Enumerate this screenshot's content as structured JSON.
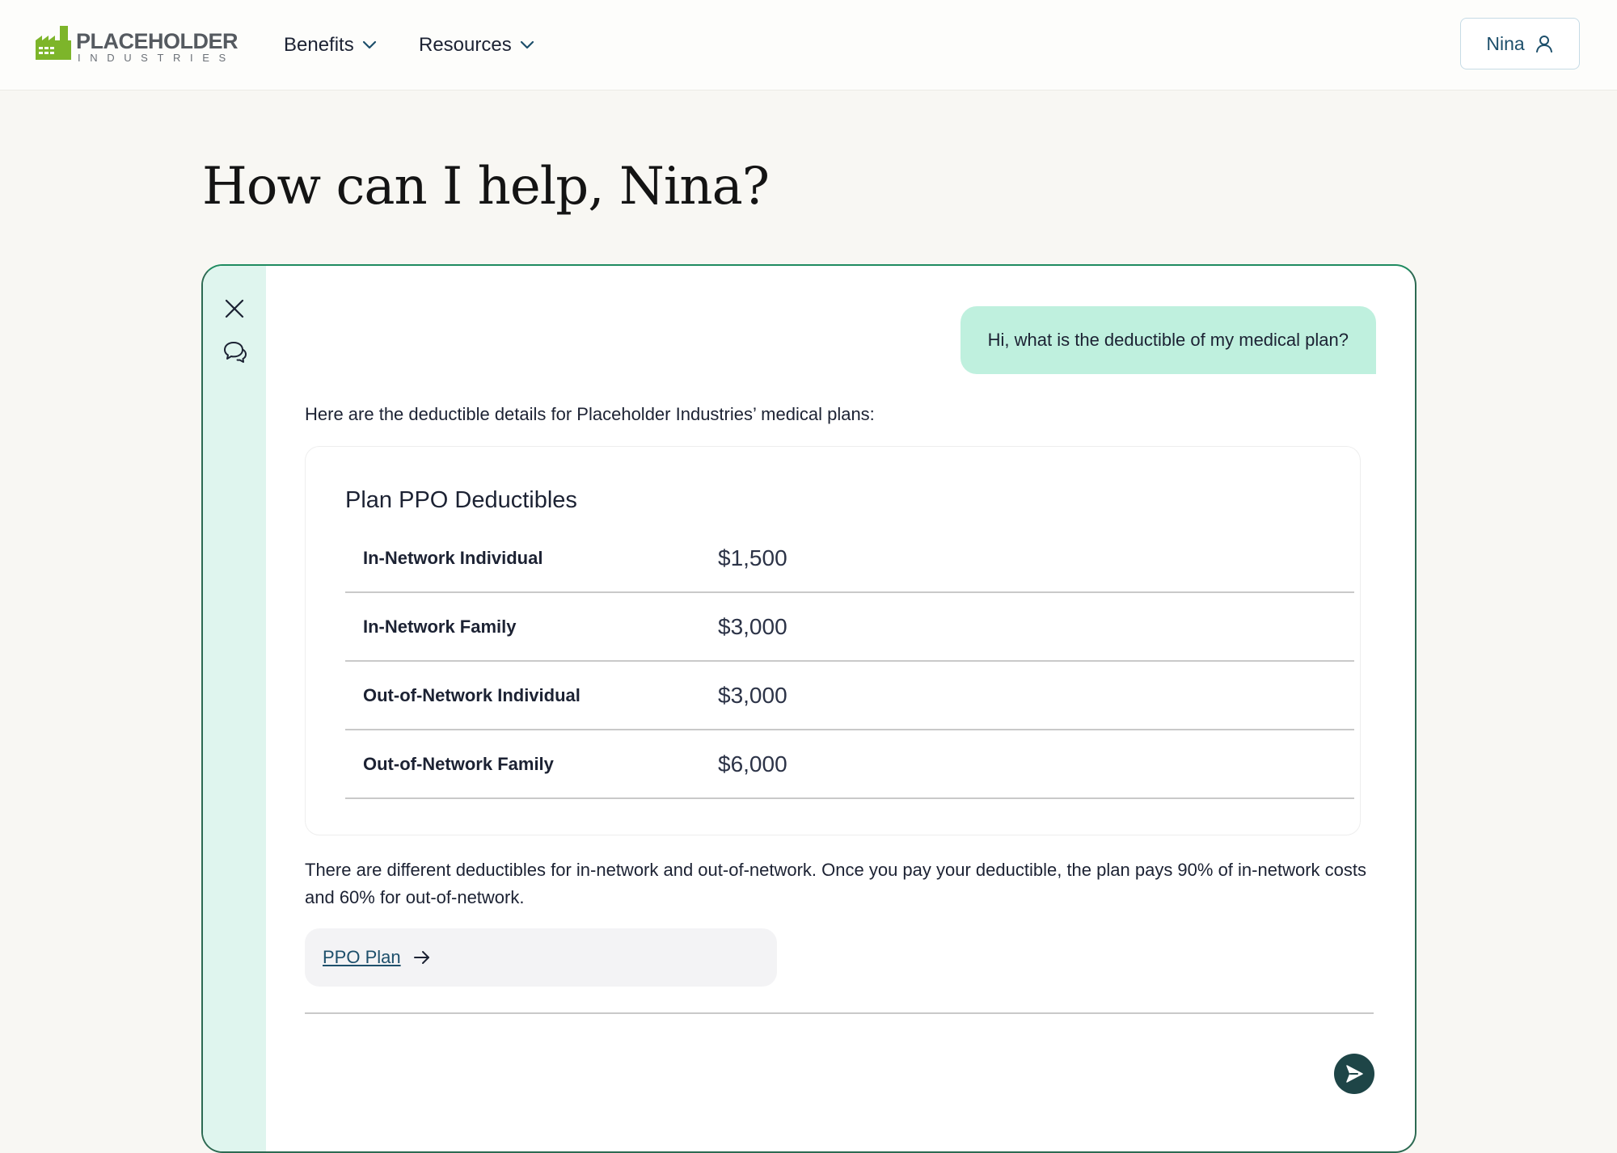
{
  "brand": {
    "name_top": "PLACEHOLDER",
    "name_bottom": "INDUSTRIES",
    "colors": {
      "logo_green": "#7db52a",
      "logo_grey": "#555a60"
    }
  },
  "nav": {
    "items": [
      {
        "label": "Benefits",
        "icon": "chevron-down-icon"
      },
      {
        "label": "Resources",
        "icon": "chevron-down-icon"
      }
    ],
    "user_button": {
      "label": "Nina",
      "icon": "user-icon"
    }
  },
  "page": {
    "title": "How can I help, Nina?"
  },
  "chat": {
    "rail_icons": [
      "close-icon",
      "chat-bubbles-icon"
    ],
    "user_message": "Hi, what is the deductible of my medical plan?",
    "assistant_intro": "Here are the deductible details for Placeholder Industries’ medical plans:",
    "deductible_card": {
      "title": "Plan PPO Deductibles",
      "rows": [
        {
          "label": "In-Network Individual",
          "value": "$1,500"
        },
        {
          "label": "In-Network Family",
          "value": "$3,000"
        },
        {
          "label": "Out-of-Network Individual",
          "value": "$3,000"
        },
        {
          "label": "Out-of-Network Family",
          "value": "$6,000"
        }
      ]
    },
    "assistant_followup": "There are different deductibles for in-network and out-of-network. Once you pay your deductible, the plan pays 90% of in-network costs and 60% for out-of-network.",
    "link": {
      "label": "PPO Plan",
      "icon": "arrow-right-icon"
    },
    "composer": {
      "placeholder": "",
      "send_icon": "send-icon"
    },
    "colors": {
      "accent_border": "#1f8b60",
      "rail_bg": "#dff5ee",
      "user_bubble_bg": "#bff0de",
      "send_button_bg": "#1e4547"
    }
  }
}
